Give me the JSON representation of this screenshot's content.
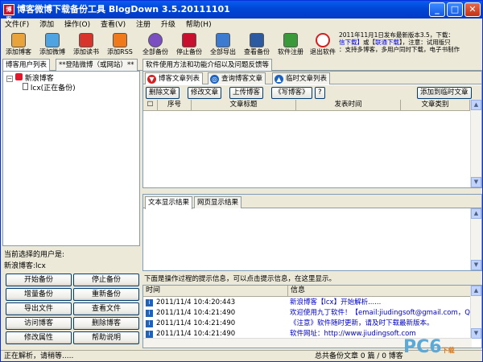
{
  "window": {
    "title": "博客微博下载备份工具 BlogDown 3.5.20111101",
    "icon_text": "博客"
  },
  "menu": [
    "文件(F)",
    "添加",
    "操作(O)",
    "查看(V)",
    "注册",
    "升级",
    "帮助(H)"
  ],
  "toolbar": [
    {
      "label": "添加博客",
      "icon": "add-blog-icon",
      "color": "#e8a33a"
    },
    {
      "label": "添加微博",
      "icon": "add-weibo-icon",
      "color": "#4ea3e0"
    },
    {
      "label": "添加读书",
      "icon": "add-book-icon",
      "color": "#d9342b"
    },
    {
      "label": "添加RSS",
      "icon": "rss-icon",
      "color": "#f07a1a"
    },
    {
      "label": "全部备份",
      "icon": "backup-all-icon",
      "color": "#7b4fc2"
    },
    {
      "label": "停止备份",
      "icon": "stop-icon",
      "color": "#c8102e"
    },
    {
      "label": "全部导出",
      "icon": "export-icon",
      "color": "#3d7bd1"
    },
    {
      "label": "查看备份",
      "icon": "view-backup-icon",
      "color": "#2c5aa0"
    },
    {
      "label": "软件注册",
      "icon": "register-icon",
      "color": "#3a9a3a"
    },
    {
      "label": "退出软件",
      "icon": "exit-icon",
      "color": "#d32020"
    }
  ],
  "notice": {
    "line1": "2011年11月1日发布最新版本3.5，下载：",
    "line2_a": "信下载】",
    "line2_b": "或【",
    "line2_c": "联通下载",
    "line2_d": "】，注意：试用版只",
    "line3": "：支持多博客，多用户同时下载，电子书制作"
  },
  "top_tabs": [
    "博客用户列表",
    "**登陆微博（或网站）**",
    "软件使用方法和功能介绍以及问题反馈等"
  ],
  "tree": {
    "root": "新浪博客",
    "child": "lcx(正在备份)"
  },
  "selected": {
    "label": "当前选择的用户是:",
    "value": "新浪博客:lcx"
  },
  "left_buttons": [
    "开始备份",
    "停止备份",
    "增量备份",
    "重新备份",
    "导出文件",
    "查看文件",
    "访问博客",
    "删除博客",
    "修改属性",
    "帮助说明"
  ],
  "article_tabs": [
    "博客文章列表",
    "查询博客文章",
    "临时文章列表"
  ],
  "article_actions": [
    "删除文章",
    "修改文章",
    "上传博客",
    "《写博客》",
    "?",
    "添加到临时文章"
  ],
  "article_columns": [
    "序号",
    "文章标题",
    "发表时间",
    "文章类别"
  ],
  "view_tabs": [
    "文本显示结果",
    "网页显示结果"
  ],
  "log_hint": "下面是操作过程的提示信息，可以点击提示信息，在这里显示。",
  "log_columns": [
    "时间",
    "信息"
  ],
  "logs": [
    {
      "time": "2011/11/4 10:4:20:443",
      "msg": "新浪博客【lcx】开始解析......"
    },
    {
      "time": "2011/11/4 10:4:21:490",
      "msg": "欢迎使用九丁软件！【email:jiudingsoft@gmail.com，Q"
    },
    {
      "time": "2011/11/4 10:4:21:490",
      "msg": "《注意》软件随时更新，请及时下载最新版本。"
    },
    {
      "time": "2011/11/4 10:4:21:490",
      "msg": "软件网址：http://www.jiudingsoft.com"
    }
  ],
  "status": {
    "left": "正在解析，请稍等.....",
    "right": "总共备份文章 0 篇 / 0 博客"
  },
  "watermark": {
    "main": "PC6",
    "sub": "下载"
  }
}
